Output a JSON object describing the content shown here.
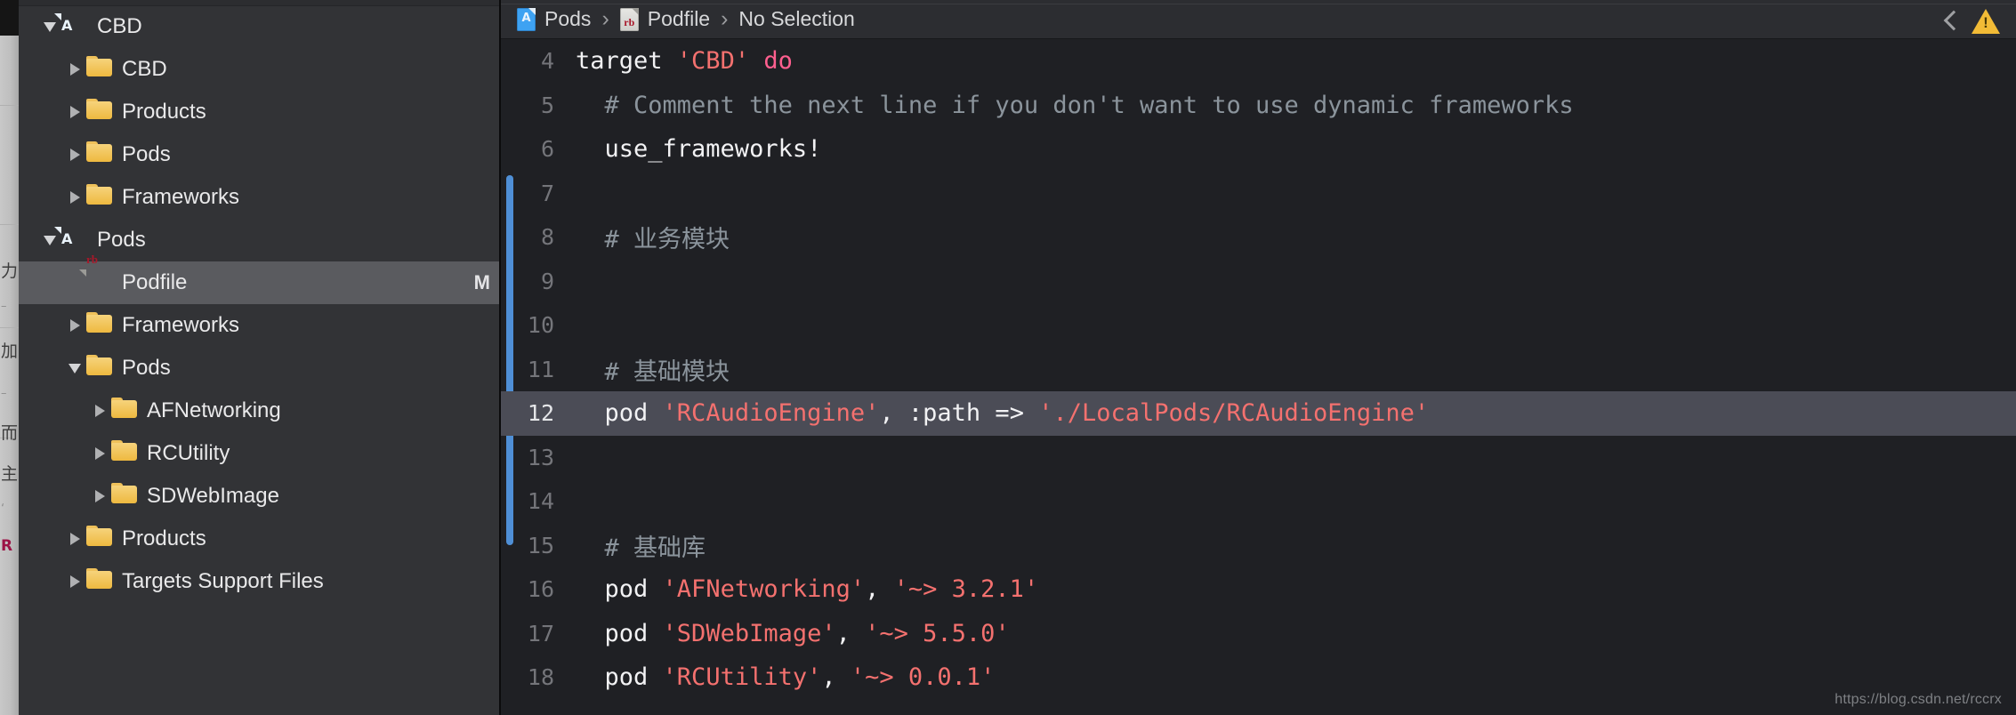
{
  "peek_strip": {
    "glyphs": [
      "力",
      "加",
      "而",
      "主",
      "尸"
    ]
  },
  "navigator": {
    "items": [
      {
        "indent": 0,
        "disc": "down",
        "icon": "xcodeproj-icon",
        "label": "CBD",
        "badge": "",
        "selected": false
      },
      {
        "indent": 1,
        "disc": "right",
        "icon": "folder-icon",
        "label": "CBD",
        "badge": "",
        "selected": false
      },
      {
        "indent": 1,
        "disc": "right",
        "icon": "folder-icon",
        "label": "Products",
        "badge": "",
        "selected": false
      },
      {
        "indent": 1,
        "disc": "right",
        "icon": "folder-icon",
        "label": "Pods",
        "badge": "",
        "selected": false
      },
      {
        "indent": 1,
        "disc": "right",
        "icon": "folder-icon",
        "label": "Frameworks",
        "badge": "",
        "selected": false
      },
      {
        "indent": 0,
        "disc": "down",
        "icon": "xcodeproj-icon",
        "label": "Pods",
        "badge": "",
        "selected": false
      },
      {
        "indent": 1,
        "disc": "none",
        "icon": "ruby-file-icon",
        "label": "Podfile",
        "badge": "M",
        "selected": true
      },
      {
        "indent": 1,
        "disc": "right",
        "icon": "folder-icon",
        "label": "Frameworks",
        "badge": "",
        "selected": false
      },
      {
        "indent": 1,
        "disc": "down",
        "icon": "folder-icon",
        "label": "Pods",
        "badge": "",
        "selected": false
      },
      {
        "indent": 2,
        "disc": "right",
        "icon": "folder-icon",
        "label": "AFNetworking",
        "badge": "",
        "selected": false
      },
      {
        "indent": 2,
        "disc": "right",
        "icon": "folder-icon",
        "label": "RCUtility",
        "badge": "",
        "selected": false
      },
      {
        "indent": 2,
        "disc": "right",
        "icon": "folder-icon",
        "label": "SDWebImage",
        "badge": "",
        "selected": false
      },
      {
        "indent": 1,
        "disc": "right",
        "icon": "folder-icon",
        "label": "Products",
        "badge": "",
        "selected": false
      },
      {
        "indent": 1,
        "disc": "right",
        "icon": "folder-icon",
        "label": "Targets Support Files",
        "badge": "",
        "selected": false
      }
    ]
  },
  "jumpbar": {
    "crumbs": [
      {
        "icon": "xcodeproj-icon",
        "label": "Pods"
      },
      {
        "icon": "ruby-file-icon",
        "label": "Podfile"
      },
      {
        "icon": "",
        "label": "No Selection"
      }
    ],
    "separator": "›",
    "back_icon": "chevron-left-icon",
    "warning_icon": "warning-triangle-icon"
  },
  "editor": {
    "change_bar_color": "#4f8fd6",
    "highlighted_line": 12,
    "lines": [
      {
        "n": "4",
        "highlight": false,
        "tokens": [
          {
            "t": "plain",
            "v": "target "
          },
          {
            "t": "str",
            "v": "'CBD'"
          },
          {
            "t": "plain",
            "v": " "
          },
          {
            "t": "kw",
            "v": "do"
          }
        ]
      },
      {
        "n": "5",
        "highlight": false,
        "tokens": [
          {
            "t": "cmt",
            "v": "  # Comment the next line if you don't want to use dynamic frameworks"
          }
        ]
      },
      {
        "n": "6",
        "highlight": false,
        "tokens": [
          {
            "t": "plain",
            "v": "  use_frameworks!"
          }
        ]
      },
      {
        "n": "7",
        "highlight": false,
        "tokens": [
          {
            "t": "plain",
            "v": ""
          }
        ]
      },
      {
        "n": "8",
        "highlight": false,
        "tokens": [
          {
            "t": "cmt",
            "v": "  # 业务模块"
          }
        ]
      },
      {
        "n": "9",
        "highlight": false,
        "tokens": [
          {
            "t": "plain",
            "v": ""
          }
        ]
      },
      {
        "n": "10",
        "highlight": false,
        "tokens": [
          {
            "t": "plain",
            "v": ""
          }
        ]
      },
      {
        "n": "11",
        "highlight": false,
        "tokens": [
          {
            "t": "cmt",
            "v": "  # 基础模块"
          }
        ]
      },
      {
        "n": "12",
        "highlight": true,
        "tokens": [
          {
            "t": "plain",
            "v": "  pod "
          },
          {
            "t": "str",
            "v": "'RCAudioEngine'"
          },
          {
            "t": "plain",
            "v": ", :path => "
          },
          {
            "t": "str",
            "v": "'./LocalPods/RCAudioEngine'"
          }
        ]
      },
      {
        "n": "13",
        "highlight": false,
        "tokens": [
          {
            "t": "plain",
            "v": ""
          }
        ]
      },
      {
        "n": "14",
        "highlight": false,
        "tokens": [
          {
            "t": "plain",
            "v": ""
          }
        ]
      },
      {
        "n": "15",
        "highlight": false,
        "tokens": [
          {
            "t": "cmt",
            "v": "  # 基础库"
          }
        ]
      },
      {
        "n": "16",
        "highlight": false,
        "tokens": [
          {
            "t": "plain",
            "v": "  pod "
          },
          {
            "t": "str",
            "v": "'AFNetworking'"
          },
          {
            "t": "plain",
            "v": ", "
          },
          {
            "t": "str",
            "v": "'~> 3.2.1'"
          }
        ]
      },
      {
        "n": "17",
        "highlight": false,
        "tokens": [
          {
            "t": "plain",
            "v": "  pod "
          },
          {
            "t": "str",
            "v": "'SDWebImage'"
          },
          {
            "t": "plain",
            "v": ", "
          },
          {
            "t": "str",
            "v": "'~> 5.5.0'"
          }
        ]
      },
      {
        "n": "18",
        "highlight": false,
        "tokens": [
          {
            "t": "plain",
            "v": "  pod "
          },
          {
            "t": "str",
            "v": "'RCUtility'"
          },
          {
            "t": "plain",
            "v": ", "
          },
          {
            "t": "str",
            "v": "'~> 0.0.1'"
          }
        ]
      }
    ]
  },
  "watermark": "https://blog.csdn.net/rccrx"
}
